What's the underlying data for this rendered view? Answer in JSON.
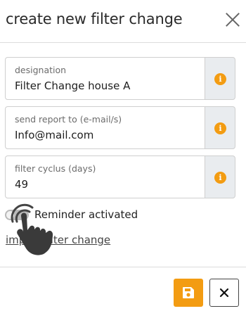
{
  "dialog": {
    "title": "create new filter change"
  },
  "fields": [
    {
      "label": "designation",
      "value": "Filter Change house A"
    },
    {
      "label": "send report to (e-mail/s)",
      "value": "Info@mail.com"
    },
    {
      "label": "filter cyclus (days)",
      "value": "49"
    }
  ],
  "info_icon_glyph": "i",
  "reminder": {
    "label": "Reminder activated",
    "enabled": false
  },
  "link": {
    "label": "import filter change"
  },
  "icons": {
    "close": "close-icon",
    "info": "info-icon",
    "save": "floppy-disk-icon",
    "cancel": "x-icon",
    "cursor": "hand-pointer-cursor-icon"
  },
  "colors": {
    "accent": "#f39c12",
    "addon_bg": "#e9ecef",
    "toggle_off": "#b9b9b9"
  }
}
